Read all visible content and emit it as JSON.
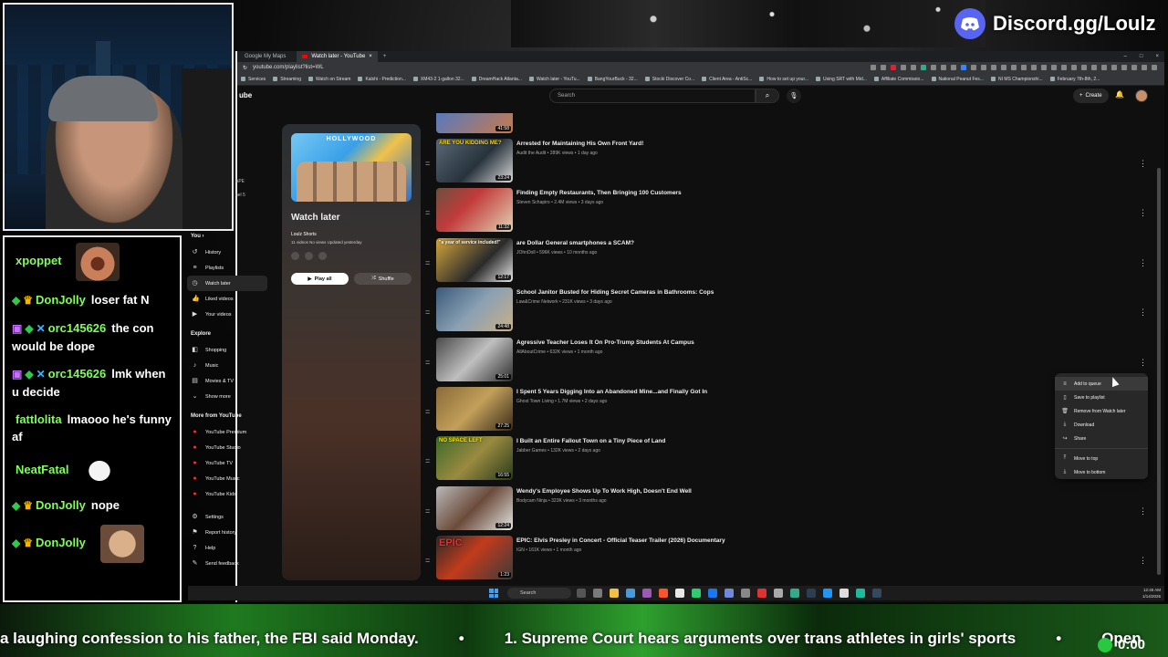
{
  "overlay": {
    "discord_text": "Discord.gg/Loulz"
  },
  "chat": {
    "messages": [
      {
        "user": "xpoppet",
        "badges": [],
        "text": "",
        "emote": "laughing-face-emote"
      },
      {
        "user": "DonJolly",
        "badges": [
          "green-diamond",
          "crown"
        ],
        "text": "loser fat N"
      },
      {
        "user": "orc145626",
        "badges": [
          "purple-gift",
          "green-diamond",
          "sword"
        ],
        "text": "the con would be dope"
      },
      {
        "user": "orc145626",
        "badges": [
          "purple-gift",
          "green-diamond",
          "sword"
        ],
        "text": "lmk when u decide"
      },
      {
        "user": "fattlolita",
        "badges": [],
        "text": "lmaooo he's funny af"
      },
      {
        "user": "NeatFatal",
        "badges": [],
        "text": "",
        "emote": "hands-emote"
      },
      {
        "user": "DonJolly",
        "badges": [
          "green-diamond",
          "crown"
        ],
        "text": "nope"
      },
      {
        "user": "DonJolly",
        "badges": [
          "green-diamond",
          "crown"
        ],
        "text": "",
        "emote": "face-emote"
      }
    ]
  },
  "browser": {
    "tabs": [
      {
        "label": "Google My Maps",
        "active": false
      },
      {
        "label": "Watch later - YouTube",
        "active": true
      }
    ],
    "url": "youtube.com/playlist?list=WL",
    "bookmarks": [
      "Services",
      "Streaming",
      "Watch on Stream",
      "Kalshi - Prediction...",
      "XM43-2 1-gallon 32...",
      "DreamHack Atlanta...",
      "Watch later - YouTu...",
      "BangYourBuck - 32...",
      "Stocki Discover Co...",
      "Client Area - AntiSc...",
      "How to set up your...",
      "Using SRT with Mid...",
      "Affiliate Commissio...",
      "National Peanut Fes...",
      "NI MS Championshi...",
      "February 7th-8th, 2..."
    ]
  },
  "youtube": {
    "logo_fragment": "ube",
    "search_placeholder": "Search",
    "create_label": "Create",
    "sidebar_cut": [
      "APE",
      "nel 5"
    ],
    "you_section": {
      "heading": "You",
      "items": [
        {
          "label": "History",
          "icon": "history-icon"
        },
        {
          "label": "Playlists",
          "icon": "playlist-icon"
        },
        {
          "label": "Watch later",
          "icon": "clock-icon",
          "active": true
        },
        {
          "label": "Liked videos",
          "icon": "thumbs-up-icon"
        },
        {
          "label": "Your videos",
          "icon": "video-icon"
        }
      ]
    },
    "explore_section": {
      "heading": "Explore",
      "items": [
        {
          "label": "Shopping",
          "icon": "bag-icon"
        },
        {
          "label": "Music",
          "icon": "music-icon"
        },
        {
          "label": "Movies & TV",
          "icon": "clapper-icon"
        },
        {
          "label": "Show more",
          "icon": "chevron-down-icon"
        }
      ]
    },
    "more_section": {
      "heading": "More from YouTube",
      "items": [
        {
          "label": "YouTube Premium"
        },
        {
          "label": "YouTube Studio"
        },
        {
          "label": "YouTube TV"
        },
        {
          "label": "YouTube Music"
        },
        {
          "label": "YouTube Kids"
        }
      ]
    },
    "footer_items": [
      {
        "label": "Settings",
        "icon": "gear-icon"
      },
      {
        "label": "Report history",
        "icon": "flag-icon"
      },
      {
        "label": "Help",
        "icon": "help-icon"
      },
      {
        "label": "Send feedback",
        "icon": "feedback-icon"
      }
    ],
    "playlist": {
      "thumb_label": "HOLLYWOOD",
      "title": "Watch later",
      "owner": "Loulz Shorts",
      "meta": "11 videos  No views  Updated yesterday",
      "play_all": "Play all",
      "shuffle": "Shuffle"
    },
    "videos": [
      {
        "title": "",
        "meta": "",
        "duration": "41:58",
        "caption": ""
      },
      {
        "title": "Arrested for Maintaining His Own Front Yard!",
        "meta": "Audit the Audit • 289K views • 1 day ago",
        "duration": "23:24",
        "caption": "ARE YOU KIDDING ME?"
      },
      {
        "title": "Finding Empty Restaurants, Then Bringing 100 Customers",
        "meta": "Steven Schapiro • 2.4M views • 3 days ago",
        "duration": "11:32",
        "caption": ""
      },
      {
        "title": "are Dollar General smartphones a SCAM?",
        "meta": "JOhnDoll • 596K views • 10 months ago",
        "duration": "12:17",
        "caption": "\"a year of service included!\""
      },
      {
        "title": "School Janitor Busted for Hiding Secret Cameras in Bathrooms: Cops",
        "meta": "Law&Crime Network • 231K views • 3 days ago",
        "duration": "24:48",
        "caption": ""
      },
      {
        "title": "Agressive Teacher Loses It On Pro-Trump Students At Campus",
        "meta": "AllAboutCrime • 632K views • 1 month ago",
        "duration": "25:01",
        "caption": ""
      },
      {
        "title": "I Spent 5 Years Digging Into an Abandoned Mine...and Finally Got In",
        "meta": "Ghost Town Living • 1.7M views • 2 days ago",
        "duration": "27:25",
        "caption": ""
      },
      {
        "title": "I Built an Entire Fallout Town on a Tiny Piece of Land",
        "meta": "Jabber Games • 132K views • 2 days ago",
        "duration": "16:55",
        "caption": "NO SPACE LEFT"
      },
      {
        "title": "Wendy's Employee Shows Up To Work High, Doesn't End Well",
        "meta": "Bodycam Ninja • 323K views • 3 months ago",
        "duration": "12:24",
        "caption": ""
      },
      {
        "title": "EPIC: Elvis Presley in Concert - Official Teaser Trailer (2026) Documentary",
        "meta": "IGN • 161K views • 1 month ago",
        "duration": "1:23",
        "caption": "EPIC"
      }
    ],
    "context_menu": [
      {
        "label": "Add to queue",
        "icon": "queue-icon"
      },
      {
        "label": "Save to playlist",
        "icon": "bookmark-icon"
      },
      {
        "label": "Remove from Watch later",
        "icon": "trash-icon"
      },
      {
        "label": "Download",
        "icon": "download-icon"
      },
      {
        "label": "Share",
        "icon": "share-icon"
      },
      {
        "label": "Move to top",
        "icon": "move-top-icon"
      },
      {
        "label": "Move to bottom",
        "icon": "move-bottom-icon"
      }
    ]
  },
  "taskbar": {
    "search": "Search",
    "time": "12:45 AM",
    "date": "1/14/2026"
  },
  "ticker": {
    "items": [
      "a laughing confession to his father, the FBI said Monday.",
      "1. Supreme Court hears arguments over trans athletes in girls' sports",
      "Open"
    ],
    "clock": "0:00"
  }
}
